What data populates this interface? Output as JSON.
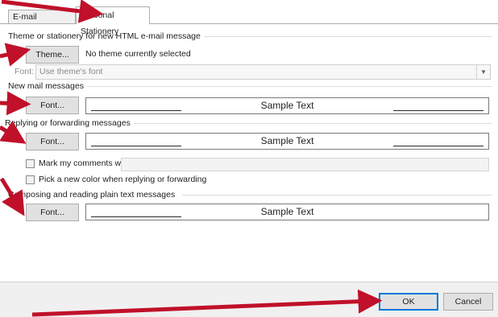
{
  "tabs": {
    "email_signature": "E-mail Signature",
    "personal_stationery": "Personal Stationery"
  },
  "theme_section": {
    "label": "Theme or stationery for new HTML e-mail message",
    "theme_button": "Theme...",
    "status": "No theme currently selected",
    "font_label": "Font:",
    "font_value": "Use theme's font"
  },
  "new_mail": {
    "label": "New mail messages",
    "font_button": "Font...",
    "sample": "Sample Text"
  },
  "reply": {
    "label": "Replying or forwarding messages",
    "font_button": "Font...",
    "sample": "Sample Text",
    "mark_comments": "Mark my comments with:",
    "new_color": "Pick a new color when replying or forwarding"
  },
  "plain_text": {
    "label": "Composing and reading plain text messages",
    "font_button": "Font...",
    "sample": "Sample Text"
  },
  "footer": {
    "ok": "OK",
    "cancel": "Cancel"
  },
  "colors": {
    "annotation_arrow": "#c0102a",
    "ok_border": "#0078d7"
  },
  "icons": {
    "dropdown": "chevron-down-icon",
    "annotation": "red-arrow-icon"
  }
}
